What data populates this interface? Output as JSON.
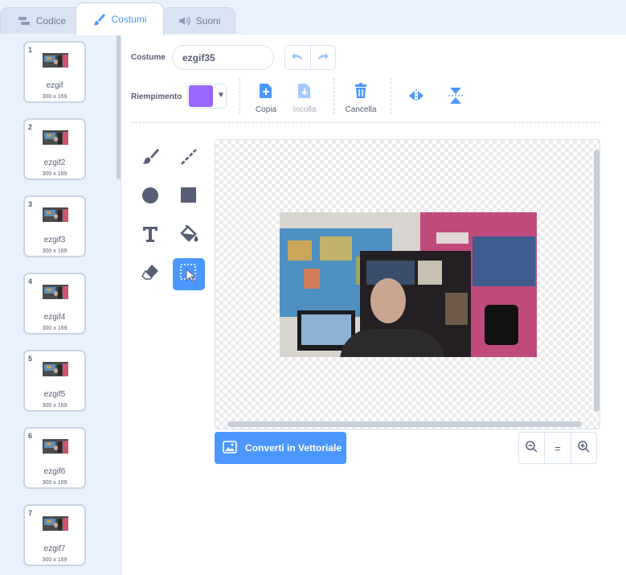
{
  "tabs": [
    {
      "label": "Codice",
      "icon": "code-icon"
    },
    {
      "label": "Costumi",
      "icon": "brush-icon"
    },
    {
      "label": "Suoni",
      "icon": "speaker-icon"
    }
  ],
  "costumes": [
    {
      "num": "1",
      "name": "ezgif",
      "size": "300 x 169"
    },
    {
      "num": "2",
      "name": "ezgif2",
      "size": "300 x 169"
    },
    {
      "num": "3",
      "name": "ezgif3",
      "size": "300 x 169"
    },
    {
      "num": "4",
      "name": "ezgif4",
      "size": "300 x 169"
    },
    {
      "num": "5",
      "name": "ezgif5",
      "size": "300 x 169"
    },
    {
      "num": "6",
      "name": "ezgif6",
      "size": "300 x 169"
    },
    {
      "num": "7",
      "name": "ezgif7",
      "size": "300 x 169"
    }
  ],
  "editor": {
    "costume_label": "Costume",
    "costume_name": "ezgif35",
    "fill_label": "Riempimento",
    "fill_color": "#9966ff",
    "copy_label": "Copia",
    "paste_label": "Incolla",
    "delete_label": "Cancella",
    "convert_label": "Converti in Vettoriale",
    "zoom_reset": "="
  },
  "colors": {
    "accent": "#4c97ff",
    "text": "#575e75",
    "sidebar_bg": "#e9f1fc"
  }
}
